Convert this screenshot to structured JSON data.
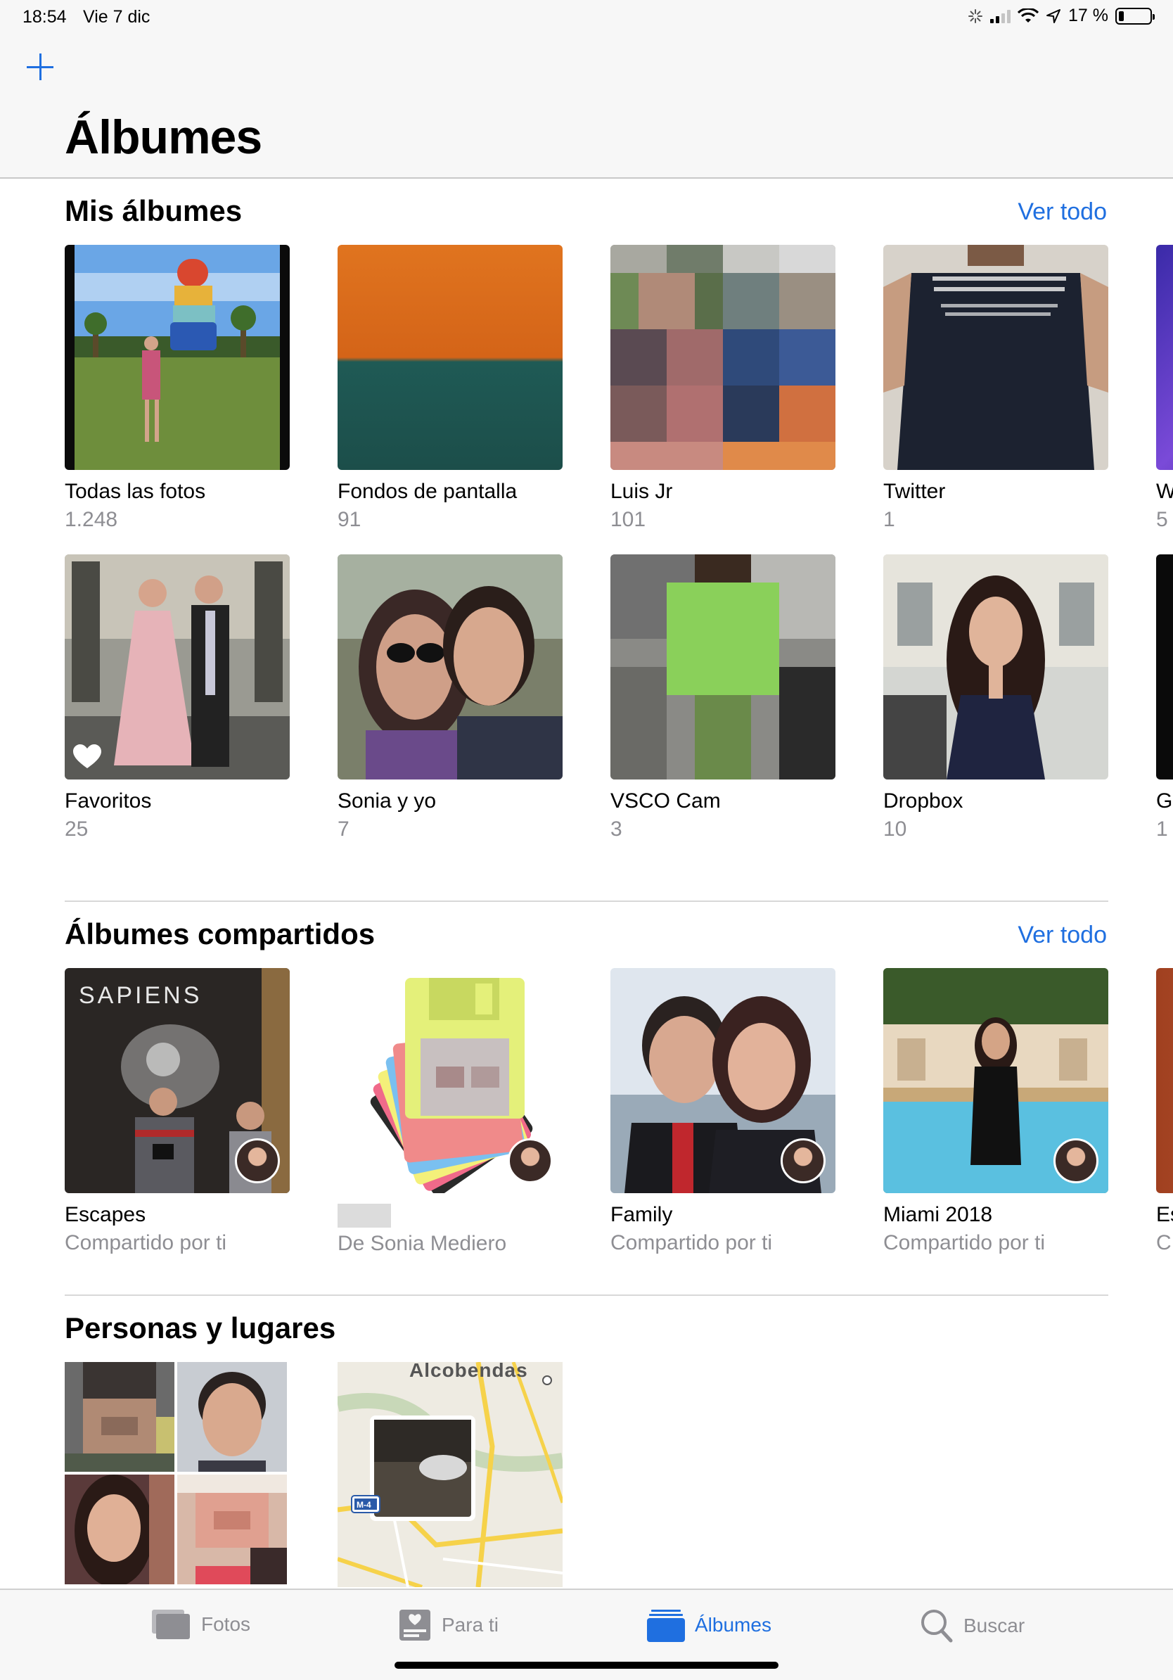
{
  "status_bar": {
    "time": "18:54",
    "date": "Vie 7 dic",
    "battery": "17 %",
    "battery_level": 0.17
  },
  "header": {
    "title": "Álbumes",
    "add_icon": "plus-icon"
  },
  "my_albums": {
    "title": "Mis álbumes",
    "see_all": "Ver todo",
    "albums": [
      {
        "name": "Todas las fotos",
        "count": "1.248"
      },
      {
        "name": "Fondos de pantalla",
        "count": "91"
      },
      {
        "name": "Luis Jr",
        "count": "101"
      },
      {
        "name": "Twitter",
        "count": "1"
      },
      {
        "name": "W",
        "count": "5"
      },
      {
        "name": "Favoritos",
        "count": "25"
      },
      {
        "name": "Sonia y yo",
        "count": "7"
      },
      {
        "name": "VSCO Cam",
        "count": "3"
      },
      {
        "name": "Dropbox",
        "count": "10"
      },
      {
        "name": "G",
        "count": "1"
      }
    ]
  },
  "shared_albums": {
    "title": "Álbumes compartidos",
    "see_all": "Ver todo",
    "albums": [
      {
        "name": "Escapes",
        "subtitle": "Compartido por ti"
      },
      {
        "name": "",
        "subtitle": "De Sonia Mediero"
      },
      {
        "name": "Family",
        "subtitle": "Compartido por ti"
      },
      {
        "name": "Miami 2018",
        "subtitle": "Compartido por ti"
      },
      {
        "name": "Es",
        "subtitle": "C"
      }
    ]
  },
  "people_places": {
    "title": "Personas y lugares",
    "map_label": "Alcobendas",
    "road_label": "M-4"
  },
  "tab_bar": {
    "tabs": [
      {
        "label": "Fotos",
        "icon": "photos-icon"
      },
      {
        "label": "Para ti",
        "icon": "for-you-icon"
      },
      {
        "label": "Álbumes",
        "icon": "albums-icon",
        "active": true
      },
      {
        "label": "Buscar",
        "icon": "search-icon"
      }
    ]
  },
  "colors": {
    "accent": "#1f6fe0",
    "secondary_text": "#8e8e93"
  }
}
